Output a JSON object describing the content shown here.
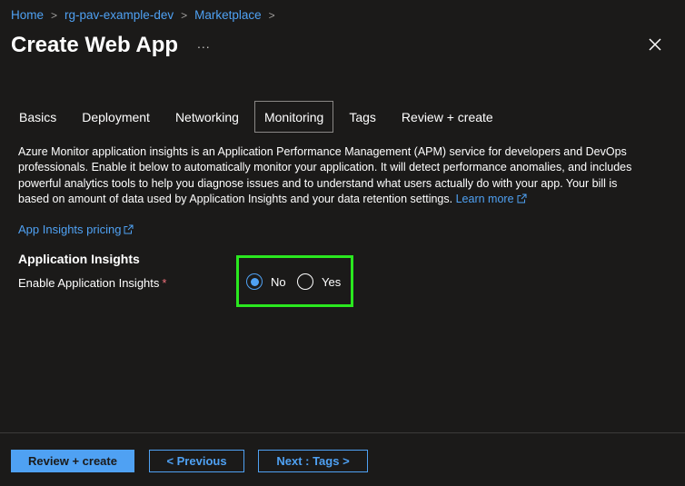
{
  "breadcrumb": {
    "items": [
      "Home",
      "rg-pav-example-dev",
      "Marketplace"
    ],
    "separator": ">"
  },
  "page": {
    "title": "Create Web App",
    "more_label": "...",
    "close_icon": "close-icon"
  },
  "tabs": [
    {
      "label": "Basics",
      "active": false
    },
    {
      "label": "Deployment",
      "active": false
    },
    {
      "label": "Networking",
      "active": false
    },
    {
      "label": "Monitoring",
      "active": true
    },
    {
      "label": "Tags",
      "active": false
    },
    {
      "label": "Review + create",
      "active": false
    }
  ],
  "description": {
    "text": "Azure Monitor application insights is an Application Performance Management (APM) service for developers and DevOps professionals. Enable it below to automatically monitor your application. It will detect performance anomalies, and includes powerful analytics tools to help you diagnose issues and to understand what users actually do with your app. Your bill is based on amount of data used by Application Insights and your data retention settings.",
    "learn_more": "Learn more"
  },
  "pricing_link": "App Insights pricing",
  "section": {
    "title": "Application Insights",
    "field_label": "Enable Application Insights",
    "required_marker": "*",
    "options": [
      "No",
      "Yes"
    ],
    "selected": "No"
  },
  "footer": {
    "review_create": "Review + create",
    "previous": "< Previous",
    "next": "Next : Tags >"
  },
  "colors": {
    "background": "#1b1a19",
    "accent": "#4fa1f3",
    "highlight_box": "#2ae81f",
    "required": "#f1707b"
  }
}
